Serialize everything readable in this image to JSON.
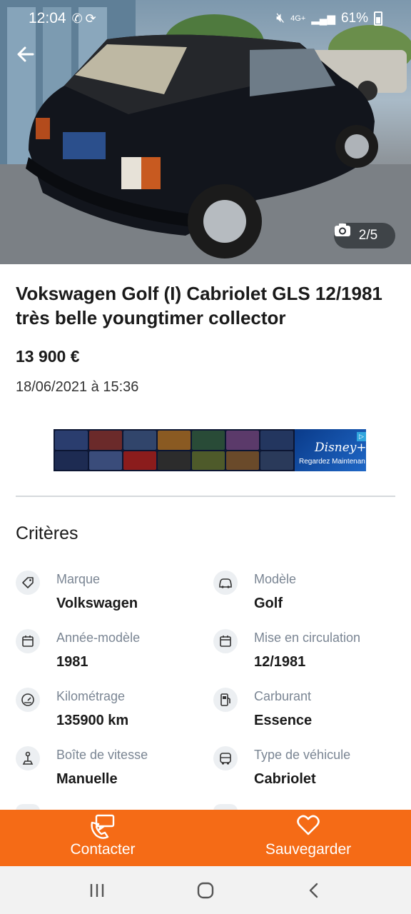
{
  "status_bar": {
    "time": "12:04",
    "left_icons": [
      "whatsapp-icon",
      "sync-icon"
    ],
    "network": "4G+",
    "battery": "61%"
  },
  "gallery": {
    "counter": "2/5"
  },
  "listing": {
    "title": "Vokswagen Golf (I) Cabriolet GLS 12/1981 très belle youngtimer collector",
    "price": "13 900 €",
    "date": "18/06/2021 à 15:36"
  },
  "ad": {
    "brand": "Disney+",
    "cta": "Regardez Maintenan"
  },
  "criteria": {
    "title": "Critères",
    "items": [
      {
        "label": "Marque",
        "value": "Volkswagen",
        "icon": "tag-icon"
      },
      {
        "label": "Modèle",
        "value": "Golf",
        "icon": "car-icon"
      },
      {
        "label": "Année-modèle",
        "value": "1981",
        "icon": "calendar-icon"
      },
      {
        "label": "Mise en circulation",
        "value": "12/1981",
        "icon": "calendar-icon"
      },
      {
        "label": "Kilométrage",
        "value": "135900 km",
        "icon": "speedometer-icon"
      },
      {
        "label": "Carburant",
        "value": "Essence",
        "icon": "fuel-pump-icon"
      },
      {
        "label": "Boîte de vitesse",
        "value": "Manuelle",
        "icon": "gear-stick-icon"
      },
      {
        "label": "Type de véhicule",
        "value": "Cabriolet",
        "icon": "vehicle-type-icon"
      }
    ]
  },
  "actions": {
    "contact": "Contacter",
    "save": "Sauvegarder"
  },
  "colors": {
    "accent": "#f56b16",
    "label": "#7a8593",
    "icon_bg": "#eceff2"
  }
}
